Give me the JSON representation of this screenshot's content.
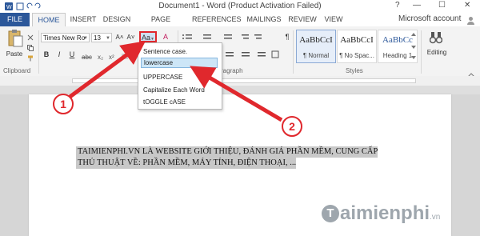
{
  "window": {
    "title": "Document1 - Word (Product Activation Failed)",
    "help": "?",
    "controls": [
      "—",
      "☐",
      "✕"
    ]
  },
  "tabs": [
    "FILE",
    "HOME",
    "INSERT",
    "DESIGN",
    "PAGE LAYOUT",
    "REFERENCES",
    "MAILINGS",
    "REVIEW",
    "VIEW"
  ],
  "account": "Microsoft account",
  "ribbon": {
    "paste": "Paste",
    "clipboard_label": "Clipboard",
    "font_name": "Times New Ro",
    "font_size": "13",
    "grow": "A˄",
    "shrink": "A˅",
    "case_button": "Aa",
    "clear_format": "A",
    "bold": "B",
    "italic": "I",
    "underline": "U",
    "paragraph_label": "ragraph",
    "pilcrow": "¶",
    "styles_label": "Styles",
    "editing_label": "Editing",
    "styles": [
      {
        "sample": "AaBbCcI",
        "name": "¶ Normal"
      },
      {
        "sample": "AaBbCcI",
        "name": "¶ No Spac..."
      },
      {
        "sample": "AaBbCc",
        "name": "Heading 1"
      }
    ]
  },
  "case_menu": [
    "Sentence case.",
    "lowercase",
    "UPPERCASE",
    "Capitalize Each Word",
    "tOGGLE cASE"
  ],
  "document": {
    "line1": "TAIMIENPHI.VN LÀ WEBSITE GIỚI THIỆU, ĐÁNH GIÁ PHẦN MỀM, CUNG CẤP",
    "line2": "THỦ THUẬT VỀ: PHẦN MỀM, MÁY TÍNH, ĐIỆN THOẠI, ..."
  },
  "callouts": [
    "1",
    "2"
  ],
  "watermark": "aimienphi",
  "watermark_mark": "T",
  "watermark_domain": ".vn",
  "colors": {
    "accent": "#2b579a",
    "callout": "#e0282d",
    "selection": "#c8c8c8",
    "menu_hover": "#cde6f7"
  }
}
